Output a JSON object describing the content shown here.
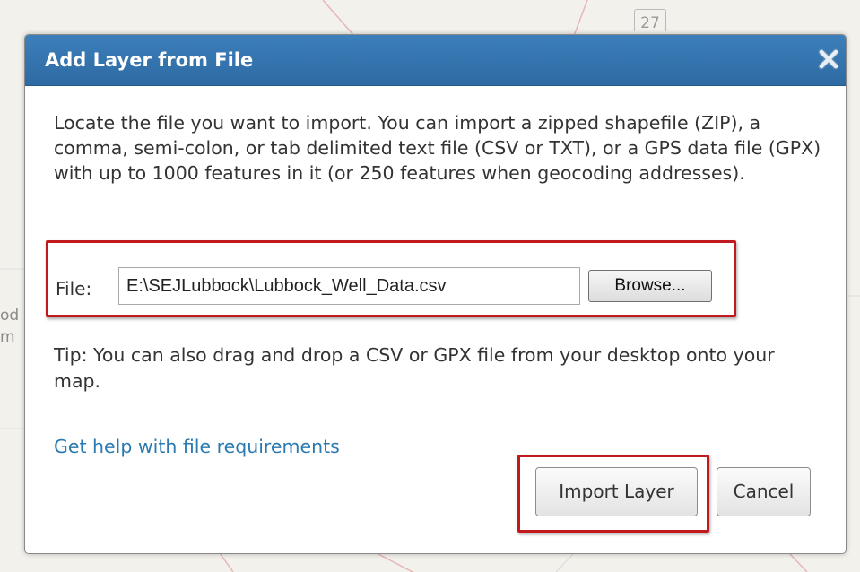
{
  "map": {
    "route_shield": "27",
    "edge_text": [
      "od",
      "m"
    ]
  },
  "dialog": {
    "title": "Add Layer from File",
    "description": "Locate the file you want to import. You can import a zipped shapefile (ZIP), a comma, semi-colon, or tab delimited text file (CSV or TXT), or a GPS data file (GPX) with up to 1000 features in it (or 250 features when geocoding addresses).",
    "file_label": "File:",
    "file_value": "E:\\SEJLubbock\\Lubbock_Well_Data.csv",
    "browse_label": "Browse...",
    "tip": "Tip: You can also drag and drop a CSV or GPX file from your desktop onto your map.",
    "help_link": "Get help with file requirements",
    "import_label": "Import Layer",
    "cancel_label": "Cancel"
  },
  "colors": {
    "title_bar": "#2e6aa3",
    "link": "#2a7ab0",
    "highlight": "#c01a1f"
  },
  "icons": {
    "close": "close-icon"
  }
}
